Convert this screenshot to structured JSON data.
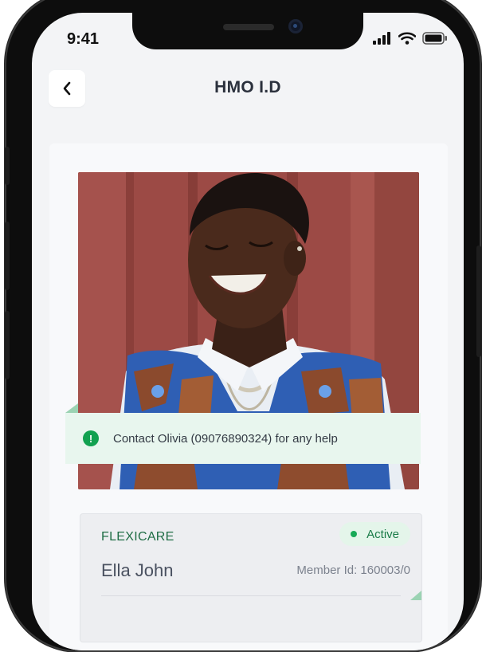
{
  "status_bar": {
    "time": "9:41"
  },
  "header": {
    "title": "HMO I.D"
  },
  "notice": {
    "text": "Contact Olivia (09076890324) for any help"
  },
  "member": {
    "plan": "FLEXICARE",
    "status": "Active",
    "name": "Ella John",
    "member_id": "Member Id: 160003/0"
  },
  "colors": {
    "accent_green": "#12a150",
    "title_dark": "#2b313d",
    "notice_bg": "#e8f6ee"
  },
  "icons": [
    "back-chevron-icon",
    "signal-icon",
    "wifi-icon",
    "battery-icon",
    "alert-icon"
  ]
}
